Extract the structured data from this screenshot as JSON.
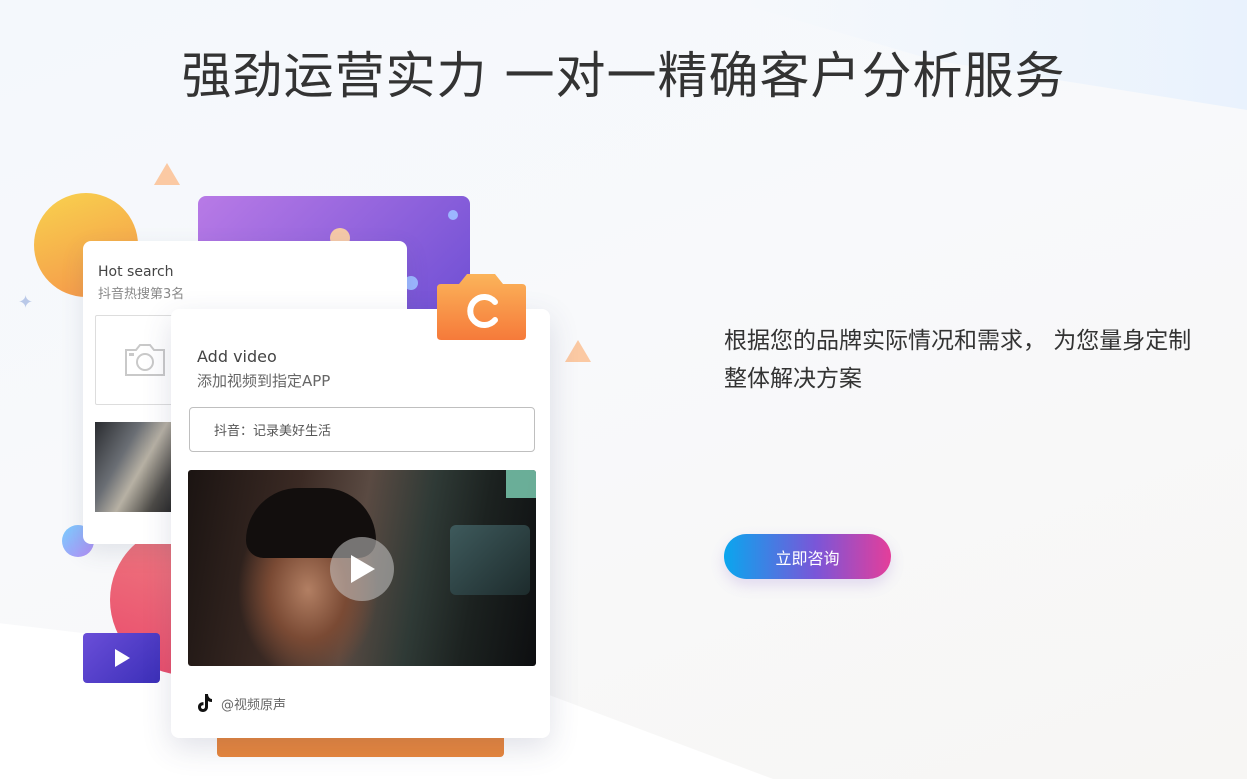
{
  "page": {
    "title": "强劲运营实力 一对一精确客户分析服务",
    "description": "根据您的品牌实际情况和需求， 为您量身定制整体解决方案",
    "cta_label": "立即咨询"
  },
  "back_card": {
    "title": "Hot search",
    "subtitle": "抖音热搜第3名"
  },
  "front_card": {
    "title": "Add video",
    "subtitle": "添加视频到指定APP",
    "input_value": "抖音：记录美好生活",
    "footer_handle": "@视频原声"
  },
  "icons": [
    "camera-icon",
    "play-icon",
    "tiktok-icon",
    "refresh-icon",
    "sparkle-icon"
  ],
  "colors": {
    "cta_gradient_start": "#0aa6ee",
    "cta_gradient_end": "#e43e9a",
    "accent_orange": "#e8863c",
    "accent_purple": "#6e4fd4"
  }
}
